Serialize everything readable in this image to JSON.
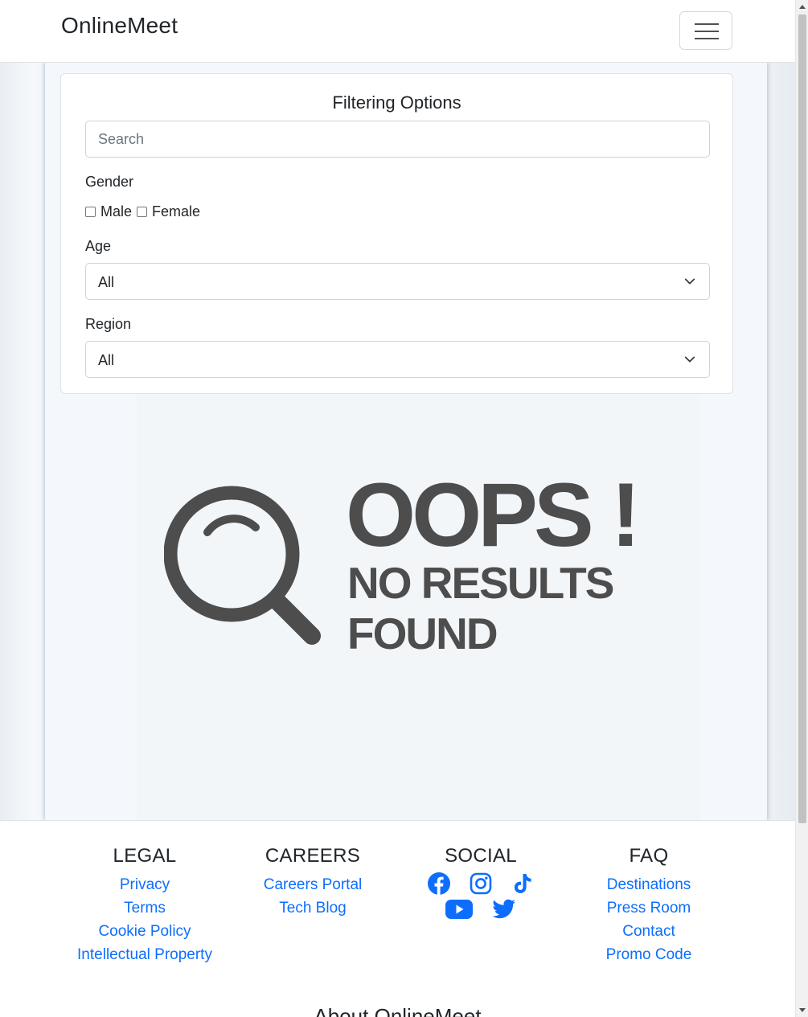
{
  "navbar": {
    "brand": "OnlineMeet",
    "menu_icon": "hamburger-icon"
  },
  "filters": {
    "title": "Filtering Options",
    "search_placeholder": "Search",
    "search_value": "",
    "gender_label": "Gender",
    "gender_options": [
      {
        "label": "Male",
        "checked": false
      },
      {
        "label": "Female",
        "checked": false
      }
    ],
    "age_label": "Age",
    "age_value": "All",
    "region_label": "Region",
    "region_value": "All"
  },
  "empty_state": {
    "icon": "magnifier-icon",
    "headline": "OOPS !",
    "line1": "NO RESULTS",
    "line2": "FOUND"
  },
  "footer": {
    "legal": {
      "title": "LEGAL",
      "links": [
        "Privacy",
        "Terms",
        "Cookie Policy",
        "Intellectual Property"
      ]
    },
    "careers": {
      "title": "CAREERS",
      "links": [
        "Careers Portal",
        "Tech Blog"
      ]
    },
    "social": {
      "title": "SOCIAL",
      "icons": [
        "facebook-icon",
        "instagram-icon",
        "tiktok-icon",
        "youtube-icon",
        "twitter-icon"
      ]
    },
    "faq": {
      "title": "FAQ",
      "links": [
        "Destinations",
        "Press Room",
        "Contact",
        "Promo Code"
      ]
    },
    "about_title": "About OnlineMeet"
  },
  "colors": {
    "link": "#0d6efd",
    "empty_state_text": "#4d4d4d"
  }
}
